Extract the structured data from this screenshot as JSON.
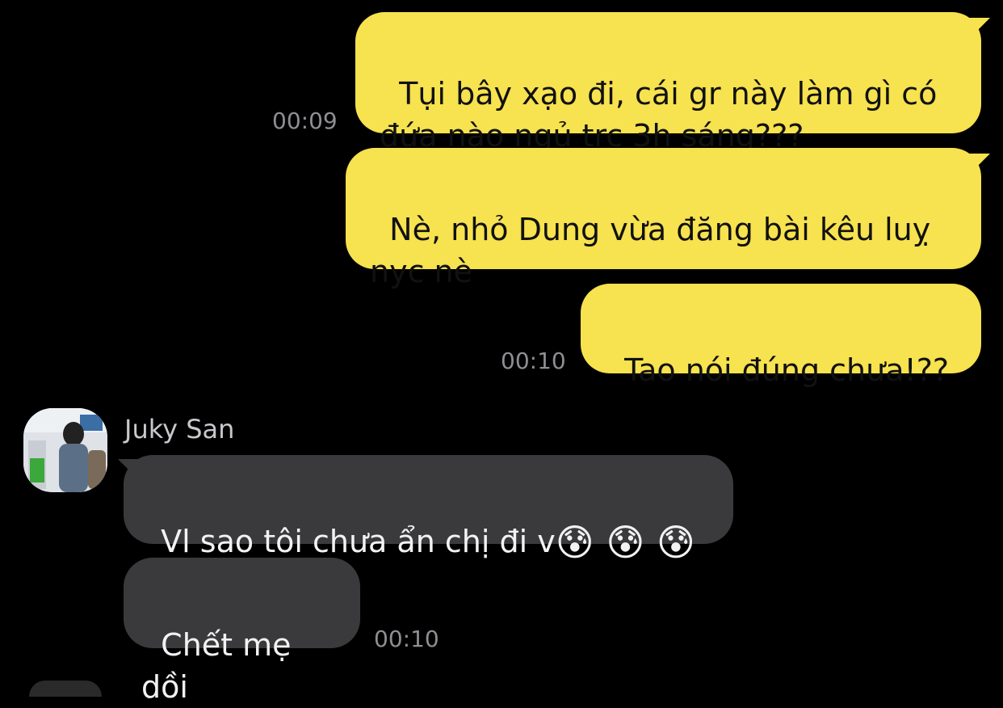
{
  "chat": {
    "outgoing": [
      {
        "text": "Tụi bây xạo đi, cái gr này làm gì có\nđứa nào ngủ trc 3h sáng???",
        "time": "00:09"
      },
      {
        "text": "Nè, nhỏ Dung vừa đăng bài kêu luỵ\nnyc nè",
        "time": ""
      },
      {
        "text": "Tao nói đúng chưa!??",
        "time": "00:10"
      }
    ],
    "incoming": {
      "sender": "Juky San",
      "avatar_icon": "user-photo-avatar",
      "messages": [
        {
          "text": "Vl sao tôi chưa ẩn chị đi v",
          "emoji": "😰 😰 😰",
          "time": ""
        },
        {
          "text": "Chết mẹ dồi",
          "time": "00:10"
        }
      ]
    }
  },
  "colors": {
    "outgoing_bubble": "#f7e24f",
    "incoming_bubble": "#3a3a3c",
    "background": "#000000",
    "timestamp": "#8e8e93"
  }
}
